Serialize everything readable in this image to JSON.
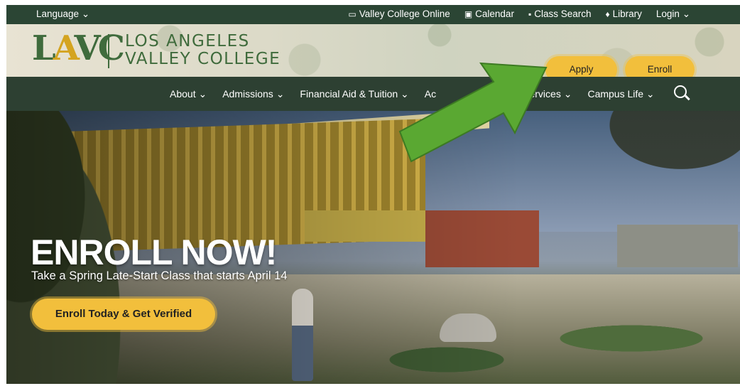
{
  "utility_bar": {
    "language": "Language ⌄",
    "links": [
      {
        "icon": "laptop-icon",
        "glyph": "▭",
        "label": "Valley College Online"
      },
      {
        "icon": "calendar-icon",
        "glyph": "▣",
        "label": "Calendar"
      },
      {
        "icon": "class-search-icon",
        "glyph": "▪",
        "label": "Class Search"
      },
      {
        "icon": "library-icon",
        "glyph": "♦",
        "label": "Library"
      }
    ],
    "login": "Login ⌄"
  },
  "header": {
    "logo_letters": [
      "L",
      "A",
      "V",
      "C"
    ],
    "logo_text_line1": "LOS ANGELES",
    "logo_text_line2": "VALLEY COLLEGE",
    "apply_label": "Apply",
    "enroll_label": "Enroll"
  },
  "nav": {
    "items": [
      {
        "label": "About ⌄"
      },
      {
        "label": "Admissions ⌄"
      },
      {
        "label": "Financial Aid & Tuition ⌄"
      },
      {
        "label": "Ac"
      },
      {
        "label": "Services ⌄"
      },
      {
        "label": "Campus Life ⌄"
      }
    ]
  },
  "hero": {
    "title": "ENROLL NOW!",
    "subtitle": "Take a Spring Late-Start Class that starts April 14",
    "button_label": "Enroll Today & Get Verified"
  },
  "colors": {
    "brand_green": "#2b4534",
    "accent_yellow": "#f2bf3c",
    "arrow_green": "#5aa832"
  }
}
